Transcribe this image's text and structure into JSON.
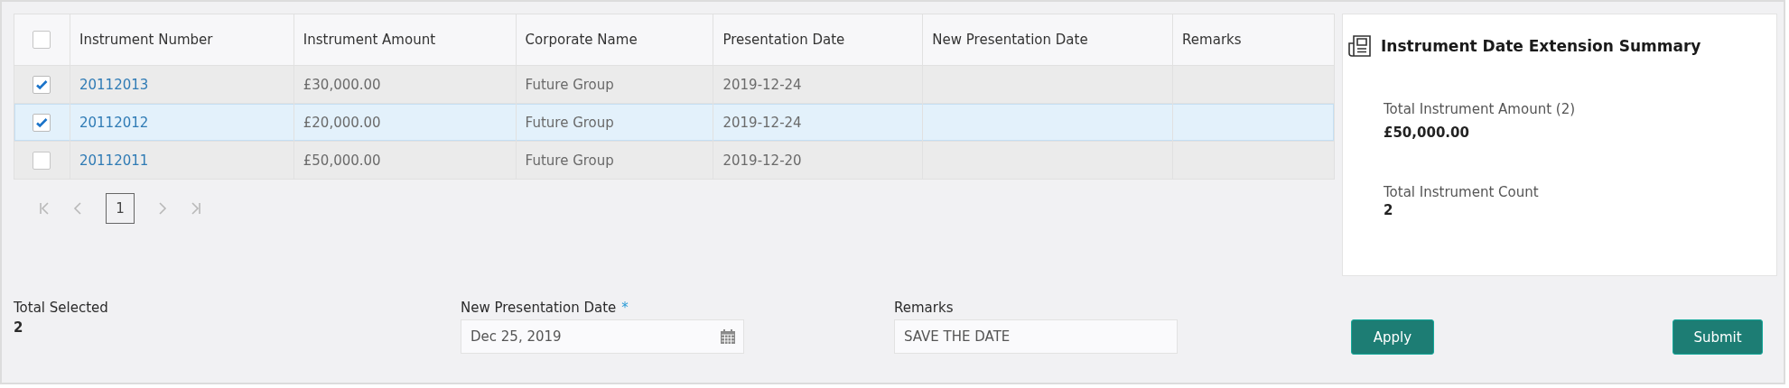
{
  "table": {
    "header_checked": false,
    "columns": [
      "Instrument Number",
      "Instrument Amount",
      "Corporate Name",
      "Presentation Date",
      "New Presentation Date",
      "Remarks"
    ],
    "rows": [
      {
        "checked": true,
        "selected": false,
        "cells": [
          "20112013",
          "£30,000.00",
          "Future Group",
          "2019-12-24",
          "",
          ""
        ]
      },
      {
        "checked": true,
        "selected": true,
        "cells": [
          "20112012",
          "£20,000.00",
          "Future Group",
          "2019-12-24",
          "",
          ""
        ]
      },
      {
        "checked": false,
        "selected": false,
        "cells": [
          "20112011",
          "£50,000.00",
          "Future Group",
          "2019-12-20",
          "",
          ""
        ]
      }
    ]
  },
  "pagination": {
    "pages": [
      {
        "label": "1",
        "selected": true
      }
    ]
  },
  "summary": {
    "title": "Instrument Date Extension Summary",
    "items": [
      {
        "label": "Total Instrument Amount (2)",
        "value": "£50,000.00"
      },
      {
        "label": "Total Instrument Count",
        "value": "2"
      }
    ]
  },
  "total_selected": {
    "label": "Total Selected",
    "value": "2"
  },
  "new_presentation_date": {
    "label": "New Presentation Date",
    "required_mark": "*",
    "value": "Dec 25, 2019"
  },
  "remarks": {
    "label": "Remarks",
    "value": "SAVE THE DATE"
  },
  "buttons": [
    "Apply",
    "Submit"
  ]
}
